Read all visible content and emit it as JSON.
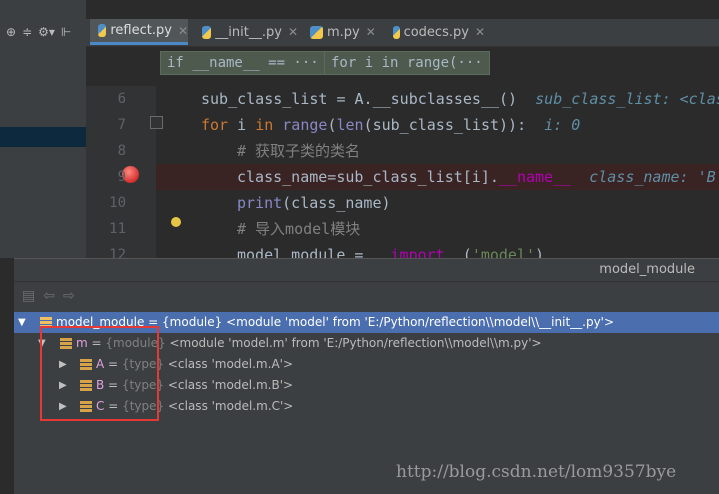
{
  "left_toolbar": {
    "icons": [
      "globe-icon",
      "split-icon",
      "gear-icon",
      "collapse-icon"
    ]
  },
  "tabs": [
    {
      "label": "reflect.py",
      "active": true
    },
    {
      "label": "__init__.py",
      "active": false
    },
    {
      "label": "m.py",
      "active": false
    },
    {
      "label": "codecs.py",
      "active": false
    }
  ],
  "breadcrumbs": [
    "if __name__ == ···",
    "for i in range(···"
  ],
  "editor": {
    "line_numbers": [
      "6",
      "7",
      "8",
      "9",
      "10",
      "11",
      "12"
    ],
    "l6": {
      "code": "sub_class_list = A.__subclasses__()",
      "hint": "sub_class_list: <clas"
    },
    "l7": {
      "kw1": "for",
      "var": " i ",
      "kw2": "in",
      "fn1": "range",
      "p1": "(",
      "fn2": "len",
      "rest": "(sub_class_list)):",
      "hint": "i: 0"
    },
    "l8": {
      "comment": "# 获取子类的类名"
    },
    "l9": {
      "code": "class_name=sub_class_list[i].",
      "dunder": "__name__",
      "hint": "class_name: 'B'"
    },
    "l10": {
      "fn": "print",
      "code": "(class_name)"
    },
    "l11": {
      "comment": "# 导入model模块"
    },
    "l12": {
      "code": "model_module = ",
      "dunder": "__import__",
      "p1": "(",
      "str": "'model'",
      "p2": ")"
    }
  },
  "debugger": {
    "title": "model_module",
    "rows": [
      {
        "name": "model_module",
        "eq": " = ",
        "type": "{module}",
        "value": " <module 'model' from 'E:/Python/reflection\\\\model\\\\__init__.py'>"
      },
      {
        "name": "m",
        "eq": " = ",
        "type": "{module}",
        "value": " <module 'model.m' from 'E:/Python/reflection\\\\model\\\\m.py'>"
      },
      {
        "name": "A",
        "eq": " = ",
        "type": "{type}",
        "value": " <class 'model.m.A'>"
      },
      {
        "name": "B",
        "eq": " = ",
        "type": "{type}",
        "value": " <class 'model.m.B'>"
      },
      {
        "name": "C",
        "eq": " = ",
        "type": "{type}",
        "value": " <class 'model.m.C'>"
      }
    ]
  },
  "watermark": "http://blog.csdn.net/lom9357bye"
}
